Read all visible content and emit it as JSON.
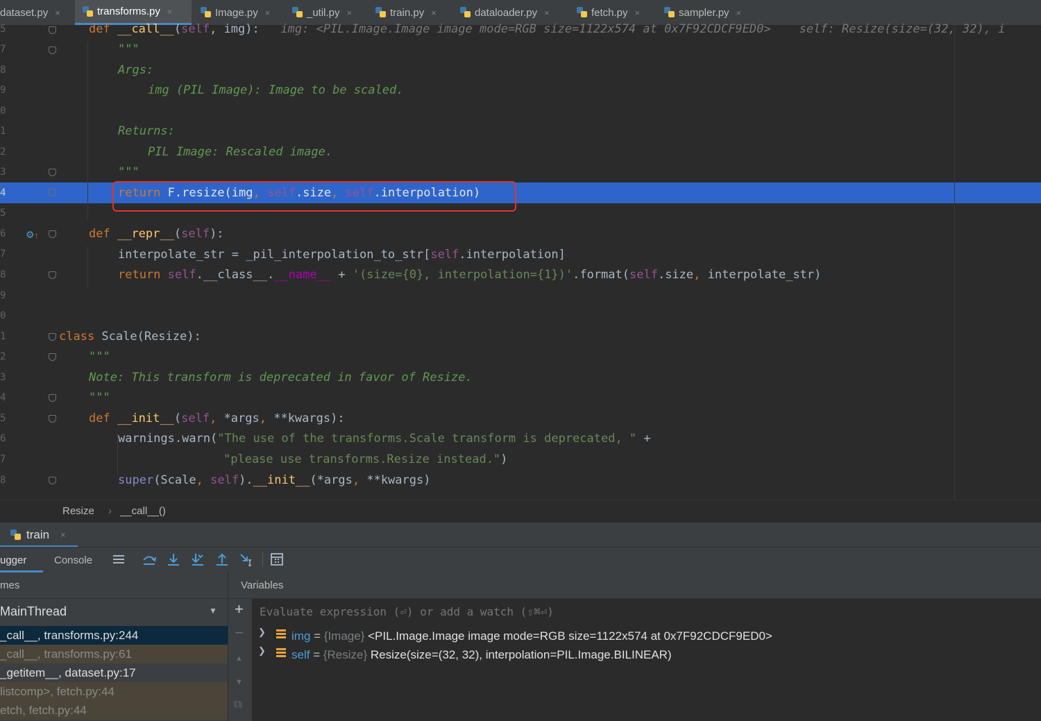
{
  "tabs": [
    {
      "label": "dataset.py",
      "active": false
    },
    {
      "label": "transforms.py",
      "active": true
    },
    {
      "label": "Image.py",
      "active": false
    },
    {
      "label": "_util.py",
      "active": false
    },
    {
      "label": "train.py",
      "active": false
    },
    {
      "label": "dataloader.py",
      "active": false
    },
    {
      "label": "fetch.py",
      "active": false
    },
    {
      "label": "sampler.py",
      "active": false
    }
  ],
  "close_glyph": "×",
  "editor": {
    "line_numbers": [
      "5",
      "7",
      "8",
      "9",
      "0",
      "1",
      "2",
      "3",
      "4",
      "5",
      "6",
      "7",
      "8",
      "9",
      "0",
      "1",
      "2",
      "3",
      "4",
      "5",
      "6",
      "7",
      "8"
    ],
    "inline_hints": {
      "img": "img: <PIL.Image.Image image mode=RGB size=1122x574 at 0x7F92CDCF9ED0>",
      "self": "self: Resize(size=(32, 32), i"
    },
    "highlighted_line": "return F.resize(img, self.size, self.interpolation)"
  },
  "breadcrumb": {
    "class": "Resize",
    "separator": "›",
    "method": "__call__()"
  },
  "run_tab": {
    "label": "train",
    "close": "×"
  },
  "debug_tabs": {
    "debugger": "ugger",
    "console": "Console"
  },
  "frames": {
    "header": "mes",
    "thread": "MainThread",
    "items": [
      {
        "label": "_call__, transforms.py:244",
        "selected": true,
        "dim": false
      },
      {
        "label": "_call__, transforms.py:61",
        "selected": false,
        "dim": true
      },
      {
        "label": "_getitem__, dataset.py:17",
        "selected": false,
        "dim": false
      },
      {
        "label": "listcomp>, fetch.py:44",
        "selected": false,
        "dim": true
      },
      {
        "label": "etch, fetch.py:44",
        "selected": false,
        "dim": true
      }
    ]
  },
  "variables": {
    "header": "Variables",
    "placeholder": "Evaluate expression (⏎) or add a watch (⇧⌘⏎)",
    "items": [
      {
        "name": "img",
        "type": "{Image}",
        "value": "<PIL.Image.Image image mode=RGB size=1122x574 at 0x7F92CDCF9ED0>"
      },
      {
        "name": "self",
        "type": "{Resize}",
        "value": "Resize(size=(32, 32), interpolation=PIL.Image.BILINEAR)"
      }
    ]
  },
  "colors": {
    "accent": "#2f65ca",
    "annotation_box": "#e0342a",
    "keyword": "#cc7832",
    "docstring": "#629755"
  }
}
